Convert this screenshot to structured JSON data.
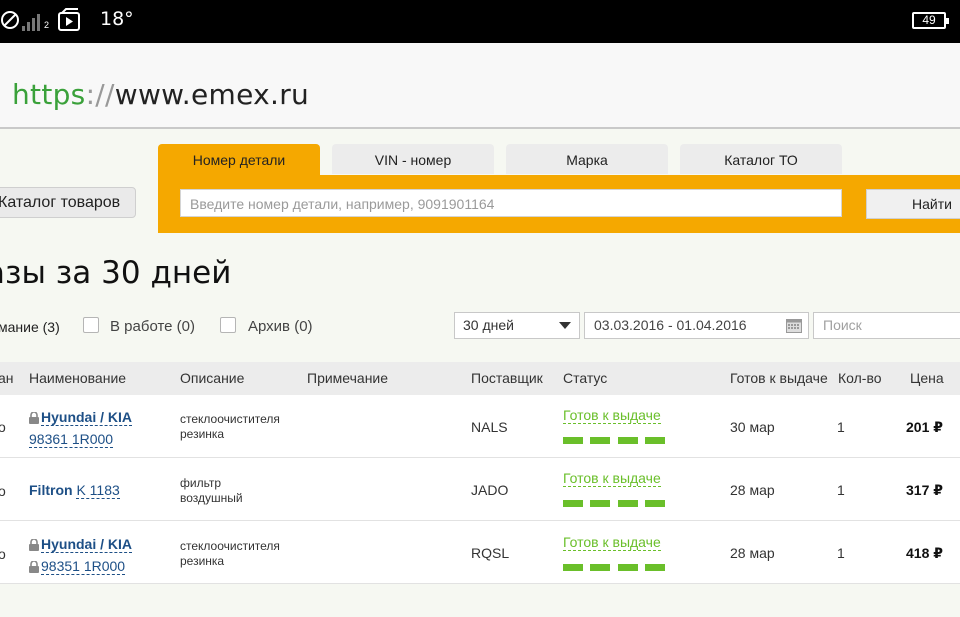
{
  "statusbar": {
    "temperature": "18°",
    "battery": "49",
    "signal_sub": "2"
  },
  "browser": {
    "url_proto": "https",
    "url_sep": "://",
    "url_host": "www.emex.ru"
  },
  "tabs": [
    {
      "label": "Номер детали",
      "active": true
    },
    {
      "label": "VIN - номер",
      "active": false
    },
    {
      "label": "Марка",
      "active": false
    },
    {
      "label": "Каталог ТО",
      "active": false
    }
  ],
  "catalog_button": "Каталог товаров",
  "search": {
    "placeholder": "Введите номер детали, например, 9091901164",
    "button": "Найти"
  },
  "page_title": "азы за 30 дней",
  "filters": [
    {
      "label": "мание (3)",
      "active": true
    },
    {
      "label": "В работе (0)",
      "active": false
    },
    {
      "label": "Архив (0)",
      "active": false
    }
  ],
  "period_select": "30 дней",
  "date_range": "03.03.2016 - 01.04.2016",
  "filter_search_placeholder": "Поиск",
  "table": {
    "headers": {
      "col0": "ан",
      "name": "Наименование",
      "description": "Описание",
      "note": "Примечание",
      "supplier": "Поставщик",
      "status": "Статус",
      "ready": "Готов к выдаче",
      "qty": "Кол-во",
      "price": "Цена"
    },
    "rows": [
      {
        "col0": "о",
        "brand": "Hyundai / KIA",
        "part": "98361 1R000",
        "desc1": "стеклоочистителя",
        "desc2": "резинка",
        "supplier": "NALS",
        "status": "Готов к выдаче",
        "ready": "30 мар",
        "qty": "1",
        "price": "201 ₽"
      },
      {
        "col0": "о",
        "brand": "Filtron",
        "part": "K 1183",
        "desc1": "фильтр",
        "desc2": "воздушный",
        "supplier": "JADO",
        "status": "Готов к выдаче",
        "ready": "28 мар",
        "qty": "1",
        "price": "317 ₽"
      },
      {
        "col0": "о",
        "brand": "Hyundai / KIA",
        "part": "98351 1R000",
        "desc1": "стеклоочистителя",
        "desc2": "резинка",
        "supplier": "RQSL",
        "status": "Готов к выдаче",
        "ready": "28 мар",
        "qty": "1",
        "price": "418 ₽"
      }
    ]
  },
  "colors": {
    "accent": "#f5a800",
    "status_green": "#6abf2a",
    "link_blue": "#1d4f86"
  }
}
